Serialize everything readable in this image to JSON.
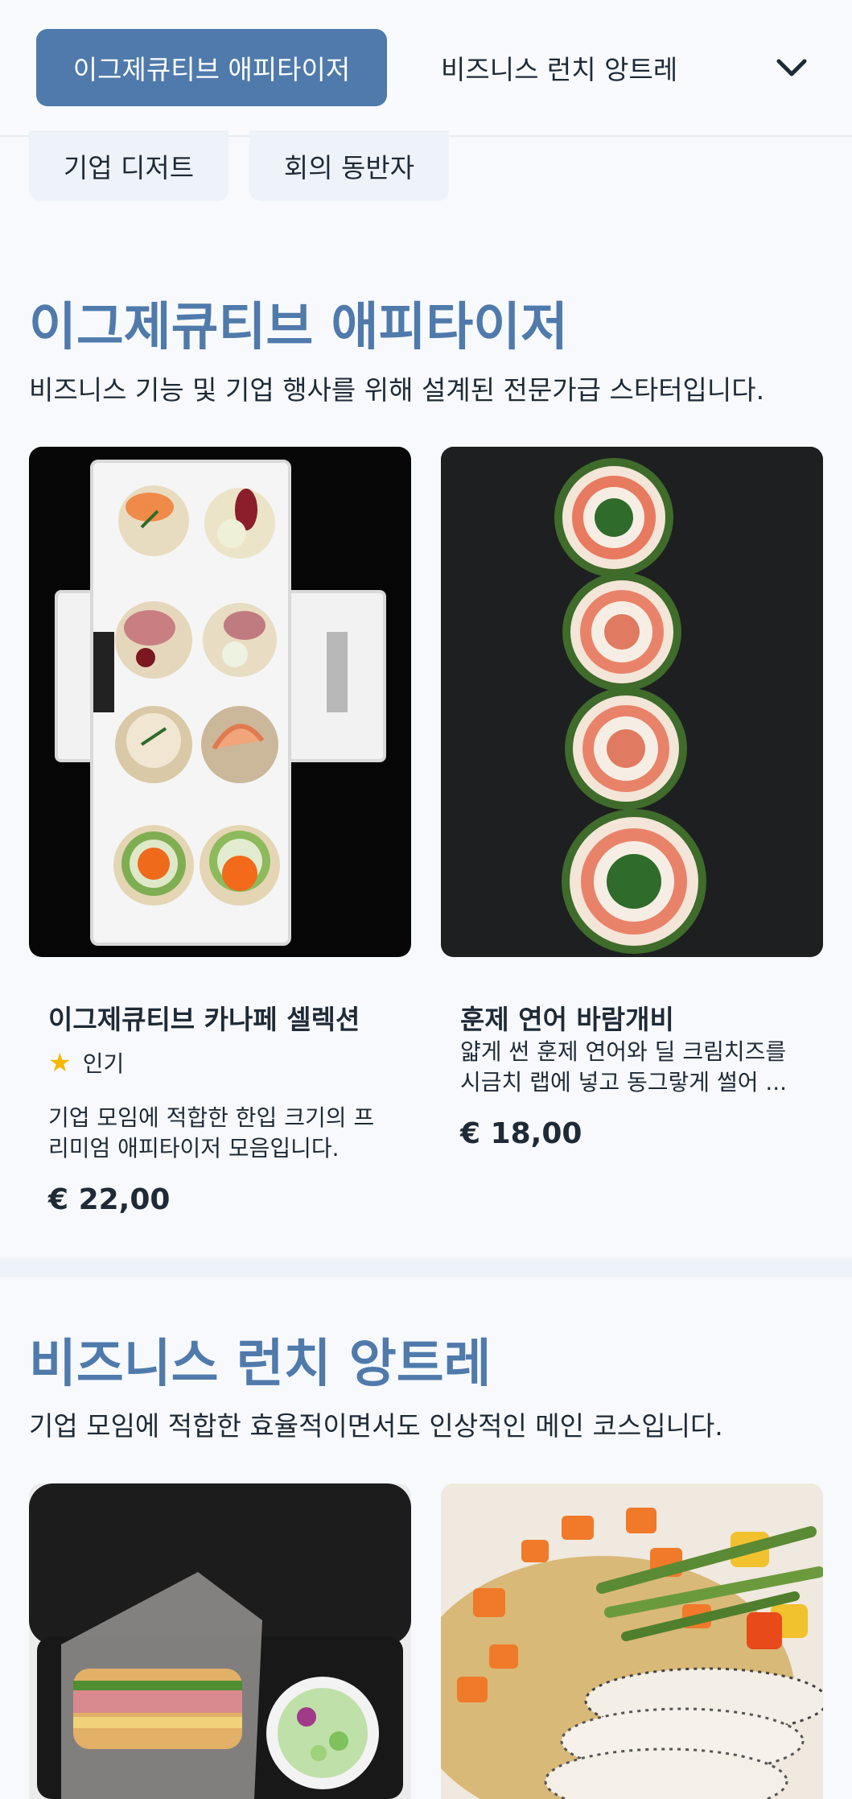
{
  "nav": {
    "active_tab": "이그제큐티브 애피타이저",
    "second_tab": "비즈니스 런치 앙트레",
    "expand_icon": "chevron-down-icon"
  },
  "chips": [
    "기업 디저트",
    "회의 동반자"
  ],
  "section1": {
    "title": "이그제큐티브 애피타이저",
    "description": "비즈니스 기능 및 기업 행사를 위해 설계된 전문가급 스타터입니다.",
    "items": [
      {
        "name": "이그제큐티브 카나페 셀렉션",
        "badge": "인기",
        "badge_icon": "star-icon",
        "description_line1": "기업 모임에 적합한 한입 크기의 프",
        "description_line2": "리미엄 애피타이저 모음입니다.",
        "price": "€ 22,00"
      },
      {
        "name": "훈제 연어 바람개비",
        "description_line1": "얇게 썬 훈제 연어와 딜 크림치즈를",
        "description_line2": "시금치 랩에 넣고 동그랗게 썰어 ...",
        "price": "€ 18,00"
      }
    ]
  },
  "section2": {
    "title": "비즈니스 런치 앙트레",
    "description": "기업 모임에 적합한 효율적이면서도 인상적인 메인 코스입니다."
  },
  "colors": {
    "accent": "#4f7aab",
    "star": "#f5b700",
    "background": "#f7f9fc"
  }
}
